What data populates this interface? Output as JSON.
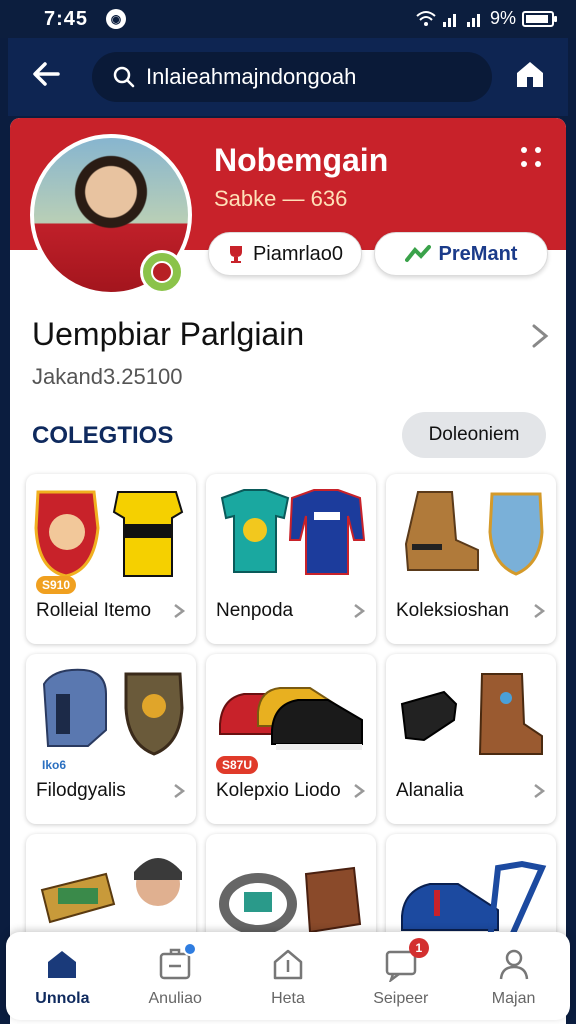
{
  "status_bar": {
    "time": "7:45",
    "battery": "9%"
  },
  "app_bar": {
    "search_text": "Inlaieahmajndongoah"
  },
  "profile": {
    "name": "Nobemgain",
    "subtitle": "Sabke — 636",
    "pill_1": "Piamrlao0",
    "pill_2": "PreMant"
  },
  "info": {
    "title": "Uempbiar Parlgiain",
    "subtitle": "Jakand3.25100"
  },
  "section": {
    "title": "COLEGTIOS",
    "button": "Doleoniem"
  },
  "cards": [
    {
      "label": "Rolleial Itemo",
      "badge": "S910"
    },
    {
      "label": "Nenpoda",
      "badge": ""
    },
    {
      "label": "Koleksioshan",
      "badge": ""
    },
    {
      "label": "Filodgyalis",
      "badge": "Iko6"
    },
    {
      "label": "Kolepxio Liodo",
      "badge": "S87U"
    },
    {
      "label": "Alanalia",
      "badge": ""
    },
    {
      "label": "",
      "badge": ""
    },
    {
      "label": "",
      "badge": ""
    },
    {
      "label": "",
      "badge": ""
    }
  ],
  "bottom_nav": [
    {
      "label": "Unnola",
      "icon": "home-icon"
    },
    {
      "label": "Anuliao",
      "icon": "box-icon"
    },
    {
      "label": "Heta",
      "icon": "house-outline-icon"
    },
    {
      "label": "Seipeer",
      "icon": "message-icon",
      "badge": "1"
    },
    {
      "label": "Majan",
      "icon": "person-icon"
    }
  ],
  "colors": {
    "accent_red": "#c8222a",
    "navy": "#0f2a5e",
    "app_bar": "#0e2552"
  }
}
